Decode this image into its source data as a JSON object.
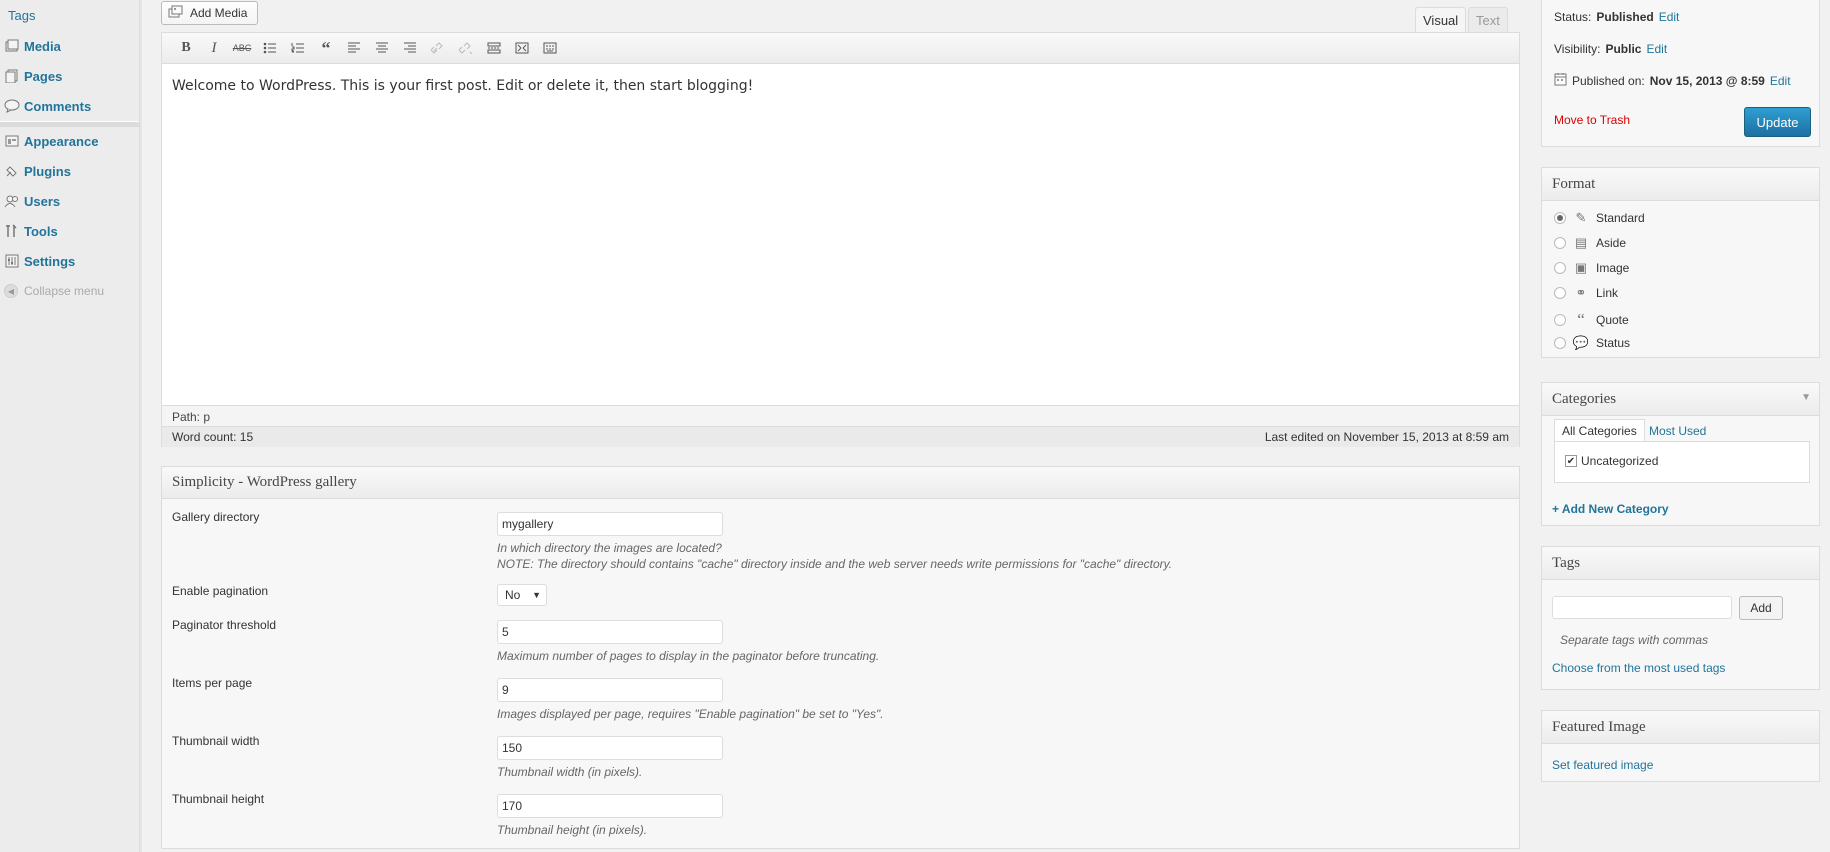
{
  "sidebar": {
    "top_item": "Tags",
    "items": [
      {
        "label": "Media",
        "icon": "media-icon"
      },
      {
        "label": "Pages",
        "icon": "pages-icon"
      },
      {
        "label": "Comments",
        "icon": "comments-icon"
      },
      {
        "label": "Appearance",
        "icon": "appearance-icon"
      },
      {
        "label": "Plugins",
        "icon": "plugins-icon"
      },
      {
        "label": "Users",
        "icon": "users-icon"
      },
      {
        "label": "Tools",
        "icon": "tools-icon"
      },
      {
        "label": "Settings",
        "icon": "settings-icon"
      }
    ],
    "collapse_label": "Collapse menu"
  },
  "editor": {
    "add_media_label": "Add Media",
    "tab_visual": "Visual",
    "tab_text": "Text",
    "content": "Welcome to WordPress. This is your first post. Edit or delete it, then start blogging!",
    "path": "Path: p",
    "word_count": "Word count: 15",
    "last_edited": "Last edited on November 15, 2013 at 8:59 am"
  },
  "gallery": {
    "title": "Simplicity - WordPress gallery",
    "directory_label": "Gallery directory",
    "directory_value": "mygallery",
    "directory_desc1": "In which directory the images are located?",
    "directory_desc2": "NOTE: The directory should contains \"cache\" directory inside and the web server needs write permissions for \"cache\" directory.",
    "pagination_label": "Enable pagination",
    "pagination_value": "No",
    "threshold_label": "Paginator threshold",
    "threshold_value": "5",
    "threshold_desc": "Maximum number of pages to display in the paginator before truncating.",
    "per_page_label": "Items per page",
    "per_page_value": "9",
    "per_page_desc": "Images displayed per page, requires \"Enable pagination\" be set to \"Yes\".",
    "thumb_width_label": "Thumbnail width",
    "thumb_width_value": "150",
    "thumb_width_desc": "Thumbnail width (in pixels).",
    "thumb_height_label": "Thumbnail height",
    "thumb_height_value": "170",
    "thumb_height_desc": "Thumbnail height (in pixels)."
  },
  "publish": {
    "status_label": "Status:",
    "status_value": "Published",
    "visibility_label": "Visibility:",
    "visibility_value": "Public",
    "published_label": "Published on:",
    "published_value": "Nov 15, 2013 @ 8:59",
    "edit_label": "Edit",
    "trash_label": "Move to Trash",
    "update_label": "Update"
  },
  "format": {
    "title": "Format",
    "options": [
      "Standard",
      "Aside",
      "Image",
      "Link",
      "Quote",
      "Status"
    ],
    "selected": "Standard"
  },
  "categories": {
    "title": "Categories",
    "tab_all": "All Categories",
    "tab_used": "Most Used",
    "item": "Uncategorized",
    "add_new": "+ Add New Category"
  },
  "tags": {
    "title": "Tags",
    "add_label": "Add",
    "hint": "Separate tags with commas",
    "choose_link": "Choose from the most used tags"
  },
  "featured": {
    "title": "Featured Image",
    "set_link": "Set featured image"
  },
  "colors": {
    "link": "#21759b",
    "update_button": "#2a95c5",
    "trash": "#dd0000"
  }
}
